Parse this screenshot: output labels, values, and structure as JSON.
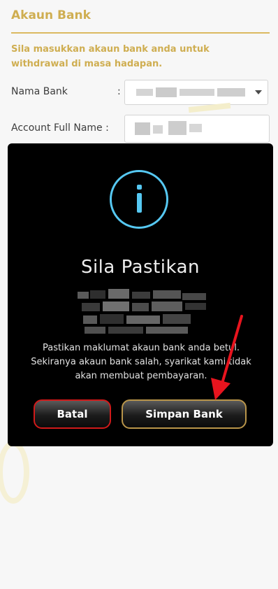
{
  "form": {
    "section_title": "Akaun Bank",
    "description": "Sila masukkan akaun bank anda untuk withdrawal di masa hadapan.",
    "bank_name_label": "Nama Bank",
    "bank_name_colon": ":",
    "account_name_label": "Account Full Name :"
  },
  "modal": {
    "icon": "info-icon",
    "title": "Sila Pastikan",
    "message": "Pastikan maklumat akaun bank anda betul. Sekiranya akaun bank salah, syarikat kami tidak akan membuat pembayaran.",
    "cancel_label": "Batal",
    "save_label": "Simpan Bank"
  },
  "colors": {
    "accent_gold": "#c9a33a",
    "info_blue": "#56c8f2",
    "cancel_border": "#d01a1a",
    "save_border": "#b9954a",
    "arrow_red": "#e8141e"
  }
}
